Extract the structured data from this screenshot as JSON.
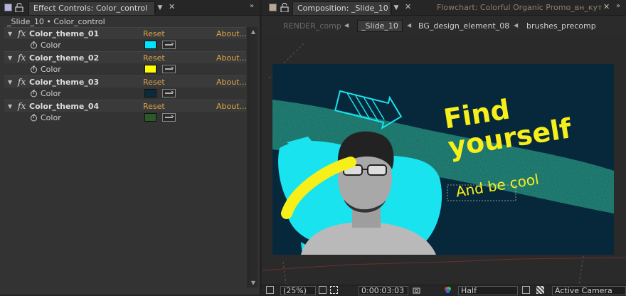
{
  "effect_controls": {
    "tab_label": "Effect Controls: Color_control",
    "breadcrumb": "_Slide_10 • Color_control",
    "effects": [
      {
        "name": "Color_theme_01",
        "reset": "Reset",
        "about": "About...",
        "prop": "Color",
        "color": "#00e5ff"
      },
      {
        "name": "Color_theme_02",
        "reset": "Reset",
        "about": "About...",
        "prop": "Color",
        "color": "#ffff00"
      },
      {
        "name": "Color_theme_03",
        "reset": "Reset",
        "about": "About...",
        "prop": "Color",
        "color": "#0b2b3c"
      },
      {
        "name": "Color_theme_04",
        "reset": "Reset",
        "about": "About...",
        "prop": "Color",
        "color": "#2a5a26"
      }
    ]
  },
  "composition": {
    "tab_label": "Composition: _Slide_10",
    "flowchart_label": "Flowchart: Colorful Organic Promo_вн_кутву",
    "flow_tabs": [
      "RENDER_comp",
      "_Slide_10",
      "BG_design_element_08",
      "brushes_precomp"
    ],
    "artboard": {
      "headline": "Find\nyourself",
      "subline": "And be cool",
      "bg_color": "#07283b",
      "accent_cyan": "#19e3ef",
      "accent_yellow": "#f7ef1a",
      "brush_green": "#1e9a86"
    },
    "footer": {
      "zoom": "(25%)",
      "timecode": "0:00:03:03",
      "resolution": "Half",
      "camera": "Active Camera"
    }
  }
}
